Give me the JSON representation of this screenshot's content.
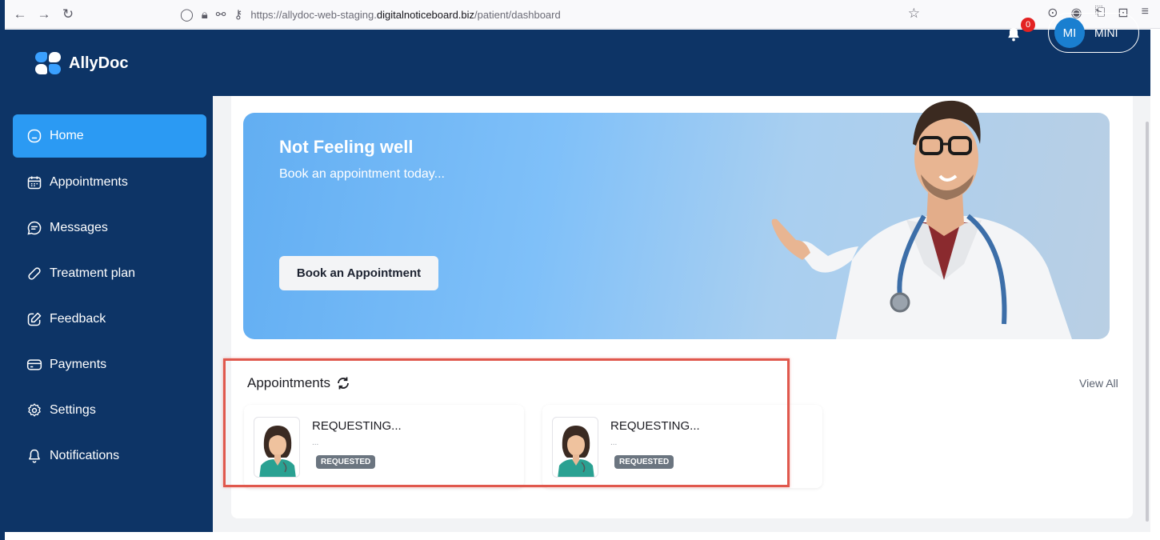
{
  "browser": {
    "url_prefix": "https://allydoc-web-staging.",
    "url_domain": "digitalnoticeboard.biz",
    "url_path": "/patient/dashboard"
  },
  "header": {
    "logo_text": "AllyDoc",
    "notification_count": "0",
    "user_initials": "MI",
    "user_name": "MINI"
  },
  "sidebar": {
    "items": [
      {
        "label": "Home",
        "icon": "home-icon"
      },
      {
        "label": "Appointments",
        "icon": "calendar-icon"
      },
      {
        "label": "Messages",
        "icon": "message-icon"
      },
      {
        "label": "Treatment plan",
        "icon": "pill-icon"
      },
      {
        "label": "Feedback",
        "icon": "edit-icon"
      },
      {
        "label": "Payments",
        "icon": "card-icon"
      },
      {
        "label": "Settings",
        "icon": "gear-icon"
      },
      {
        "label": "Notifications",
        "icon": "bell-icon"
      }
    ]
  },
  "banner": {
    "title": "Not Feeling well",
    "subtitle": "Book an appointment today...",
    "button_label": "Book an Appointment"
  },
  "appointments": {
    "title": "Appointments",
    "view_all": "View All",
    "cards": [
      {
        "status": "REQUESTING...",
        "sub": "...",
        "badge": "REQUESTED"
      },
      {
        "status": "REQUESTING...",
        "sub": "...",
        "badge": "REQUESTED"
      }
    ]
  },
  "colors": {
    "header_bg": "#0d3466",
    "active_item": "#2b9af3",
    "badge_red": "#e32222",
    "highlight": "#e0584d"
  }
}
